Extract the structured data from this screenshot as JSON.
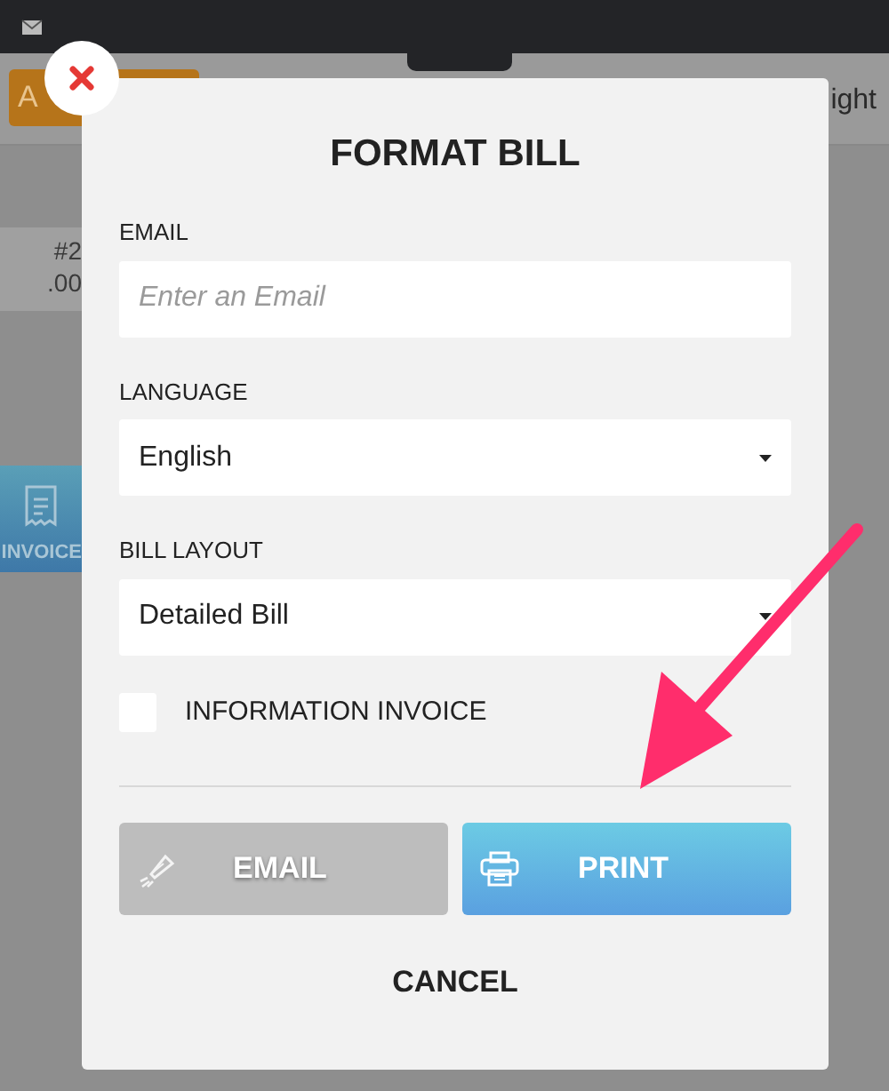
{
  "background": {
    "add_button": "A",
    "header_text": "ight",
    "ticket": {
      "number": "#2",
      "amount": ".00"
    },
    "invoice_button": "INVOICE"
  },
  "dialog": {
    "title": "FORMAT BILL",
    "fields": [
      {
        "kind": "text",
        "label": "EMAIL",
        "placeholder": "Enter an Email"
      },
      {
        "kind": "select",
        "label": "LANGUAGE",
        "value": "English"
      },
      {
        "kind": "select",
        "label": "BILL LAYOUT",
        "value": "Detailed Bill"
      }
    ],
    "checkbox": {
      "label": "INFORMATION INVOICE",
      "checked": false
    },
    "buttons": [
      {
        "kind": "email",
        "label": "EMAIL",
        "disabled": true
      },
      {
        "kind": "print",
        "label": "PRINT",
        "disabled": false
      }
    ],
    "cancel": "CANCEL"
  }
}
